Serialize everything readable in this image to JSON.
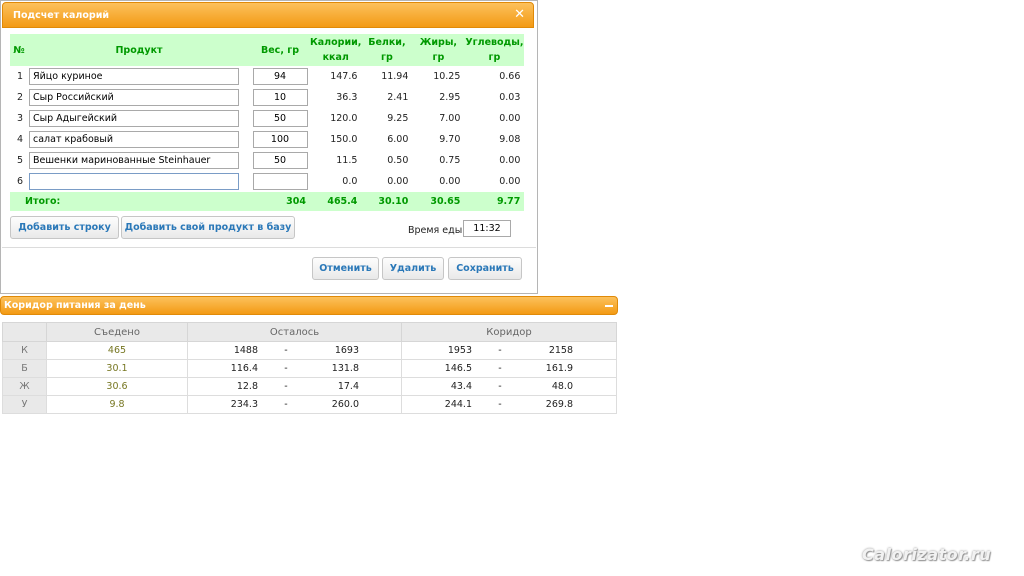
{
  "dialog": {
    "title": "Подсчет калорий",
    "columns": {
      "index": "№",
      "product": "Продукт",
      "weight": "Вес, гр",
      "calories": [
        "Калории,",
        "ккал"
      ],
      "protein": "Белки, гр",
      "fat": "Жиры, гр",
      "carbs": [
        "Углеводы,",
        "гр"
      ]
    },
    "rows": [
      {
        "index": "1",
        "product": "Яйцо куриное",
        "weight": "94",
        "calories": "147.6",
        "protein": "11.94",
        "fat": "10.25",
        "carbs": "0.66"
      },
      {
        "index": "2",
        "product": "Сыр Российский",
        "weight": "10",
        "calories": "36.3",
        "protein": "2.41",
        "fat": "2.95",
        "carbs": "0.03"
      },
      {
        "index": "3",
        "product": "Сыр Адыгейский",
        "weight": "50",
        "calories": "120.0",
        "protein": "9.25",
        "fat": "7.00",
        "carbs": "0.00"
      },
      {
        "index": "4",
        "product": "салат крабовый",
        "weight": "100",
        "calories": "150.0",
        "protein": "6.00",
        "fat": "9.70",
        "carbs": "9.08"
      },
      {
        "index": "5",
        "product": "Вешенки маринованные Steinhauer",
        "weight": "50",
        "calories": "11.5",
        "protein": "0.50",
        "fat": "0.75",
        "carbs": "0.00"
      },
      {
        "index": "6",
        "product": "",
        "weight": "",
        "calories": "0.0",
        "protein": "0.00",
        "fat": "0.00",
        "carbs": "0.00"
      }
    ],
    "totals": {
      "label": "Итого:",
      "weight": "304",
      "calories": "465.4",
      "protein": "30.10",
      "fat": "30.65",
      "carbs": "9.77"
    },
    "buttons": {
      "add_row": "Добавить строку",
      "add_product": "Добавить свой продукт в базу",
      "cancel": "Отменить",
      "delete": "Удалить",
      "save": "Сохранить"
    },
    "meal_time": {
      "label": "Время еды:",
      "value": "11:32"
    }
  },
  "corridor": {
    "title": "Коридор питания за день",
    "columns": {
      "eaten": "Съедено",
      "remaining": "Осталось",
      "corridor": "Коридор"
    },
    "rows": [
      {
        "label": "К",
        "eaten": "465",
        "remaining_min": "1488",
        "remaining_max": "1693",
        "corridor_min": "1953",
        "corridor_max": "2158"
      },
      {
        "label": "Б",
        "eaten": "30.1",
        "remaining_min": "116.4",
        "remaining_max": "131.8",
        "corridor_min": "146.5",
        "corridor_max": "161.9"
      },
      {
        "label": "Ж",
        "eaten": "30.6",
        "remaining_min": "12.8",
        "remaining_max": "17.4",
        "corridor_min": "43.4",
        "corridor_max": "48.0"
      },
      {
        "label": "У",
        "eaten": "9.8",
        "remaining_min": "234.3",
        "remaining_max": "260.0",
        "corridor_min": "244.1",
        "corridor_max": "269.8"
      }
    ],
    "dash": "-"
  },
  "watermark": "Calorizator.ru"
}
